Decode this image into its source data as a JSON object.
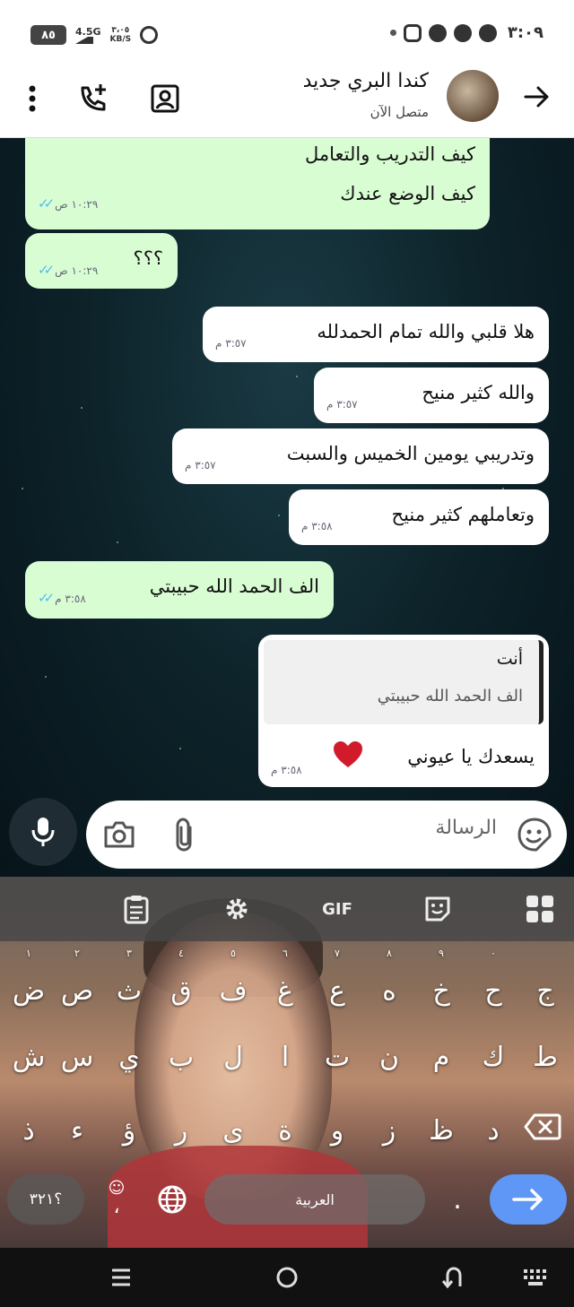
{
  "status_bar": {
    "battery": "٨٥",
    "network": "4.5G",
    "speed_value": "٣،٠٥",
    "speed_unit": "KB/S",
    "time": "٣:٠٩"
  },
  "header": {
    "contact_name": "كندا البري جديد",
    "status": "متصل الآن"
  },
  "messages": [
    {
      "text_line1": "كيف التدريب والتعامل",
      "text_line2": "كيف الوضع عندك",
      "time": "١٠:٢٩ ص"
    },
    {
      "text": "؟؟؟",
      "time": "١٠:٢٩ ص"
    },
    {
      "text": "هلا قلبي والله  تمام الحمدلله",
      "time": "٣:٥٧ م"
    },
    {
      "text": "والله  كثير منيح",
      "time": "٣:٥٧ م"
    },
    {
      "text": "وتدريبي يومين الخميس والسبت",
      "time": "٣:٥٧ م"
    },
    {
      "text": "وتعاملهم كثير منيح",
      "time": "٣:٥٨ م"
    },
    {
      "text": "الف الحمد الله حبيبتي",
      "time": "٣:٥٨ م"
    },
    {
      "quote_author": "أنت",
      "quote_text": "الف الحمد الله حبيبتي",
      "text": "يسعدك  يا عيوني",
      "time": "٣:٥٨ م"
    }
  ],
  "composer": {
    "placeholder": "الرسالة"
  },
  "keyboard": {
    "toolbar_gif": "GIF",
    "row1": [
      "ض",
      "ص",
      "ث",
      "ق",
      "ف",
      "غ",
      "ع",
      "ه",
      "خ",
      "ح",
      "ج"
    ],
    "row1_hints": [
      "١",
      "٢",
      "٣",
      "٤",
      "٥",
      "٦",
      "٧",
      "٨",
      "٩",
      "٠",
      ""
    ],
    "row2": [
      "ش",
      "س",
      "ي",
      "ب",
      "ل",
      "ا",
      "ت",
      "ن",
      "م",
      "ك",
      "ط"
    ],
    "row3": [
      "ذ",
      "ء",
      "ؤ",
      "ر",
      "ى",
      "ة",
      "و",
      "ز",
      "ظ",
      "د"
    ],
    "num_label": "؟٣٢١",
    "space_label": "العربية",
    "comma": "،",
    "period": "."
  },
  "colors": {
    "outgoing_bubble": "#d9fdd3",
    "incoming_bubble": "#ffffff",
    "read_ticks": "#53bdeb",
    "enter_key": "#5e97f6"
  }
}
